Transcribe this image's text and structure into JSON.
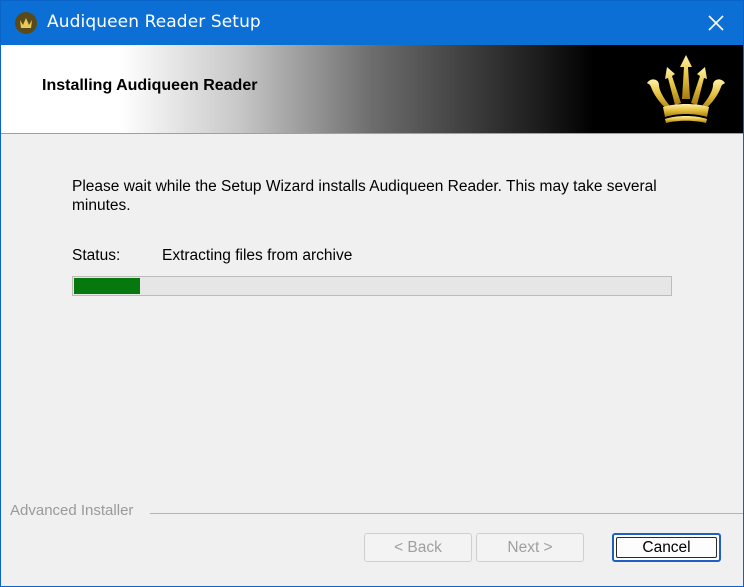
{
  "window": {
    "title": "Audiqueen Reader Setup",
    "app_icon": "crown-icon",
    "close_icon": "close-icon"
  },
  "banner": {
    "heading": "Installing Audiqueen Reader",
    "logo_icon": "crown-logo-icon"
  },
  "content": {
    "description": "Please wait while the Setup Wizard installs Audiqueen Reader.  This may take several minutes.",
    "status_label": "Status:",
    "status_value": "Extracting files from archive",
    "progress_fraction": 0.11
  },
  "footer": {
    "brand": "Advanced Installer",
    "back_label": "< Back",
    "next_label": "Next >",
    "cancel_label": "Cancel"
  },
  "colors": {
    "titlebar": "#0b6fd6",
    "progress_fill": "#06780e",
    "dialog_bg": "#f0f0f0"
  }
}
